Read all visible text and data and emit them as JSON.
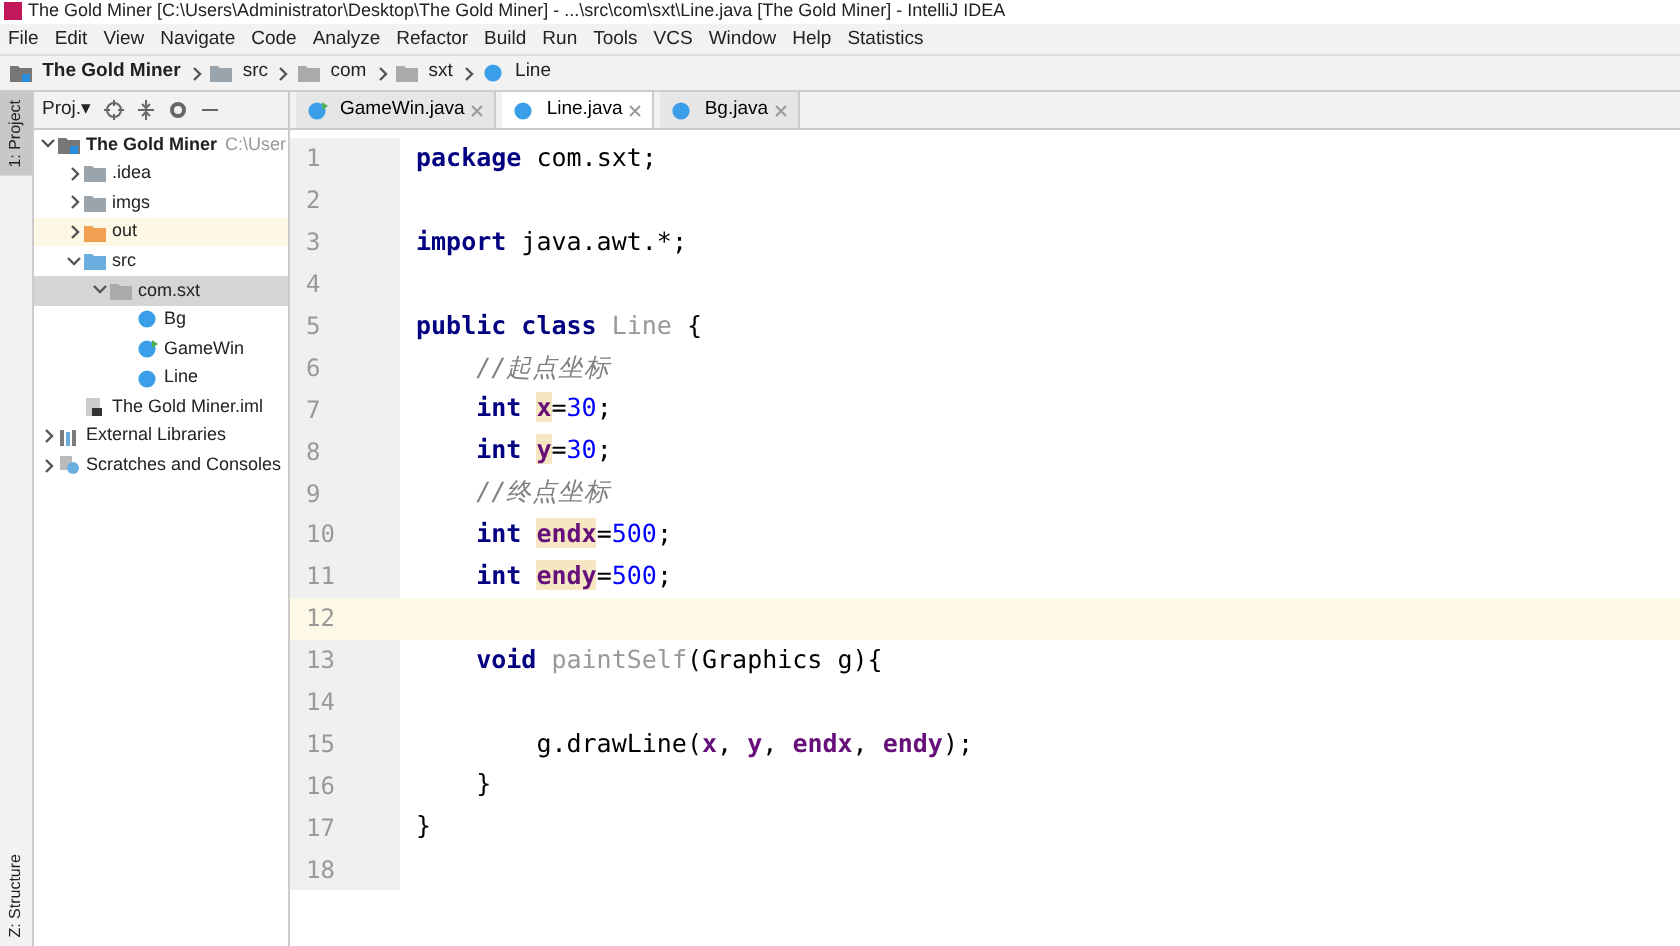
{
  "window": {
    "title": "The Gold Miner [C:\\Users\\Administrator\\Desktop\\The Gold Miner] - ...\\src\\com\\sxt\\Line.java [The Gold Miner] - IntelliJ IDEA"
  },
  "menu": [
    "File",
    "Edit",
    "View",
    "Navigate",
    "Code",
    "Analyze",
    "Refactor",
    "Build",
    "Run",
    "Tools",
    "VCS",
    "Window",
    "Help",
    "Statistics"
  ],
  "breadcrumb": [
    {
      "kind": "module",
      "label": "The Gold Miner"
    },
    {
      "kind": "folder",
      "label": "src"
    },
    {
      "kind": "package",
      "label": "com"
    },
    {
      "kind": "package",
      "label": "sxt"
    },
    {
      "kind": "class",
      "label": "Line"
    }
  ],
  "side_strip": [
    {
      "label": "1: Project",
      "selected": true
    },
    {
      "label": "Z: Structure",
      "selected": false
    }
  ],
  "project_panel": {
    "title": "Proj.▾"
  },
  "tree": [
    {
      "kind": "module",
      "label": "The Gold Miner",
      "path": "C:\\User",
      "expanded": true,
      "selected": false,
      "children": [
        {
          "kind": "folder",
          "label": ".idea",
          "expanded": false,
          "selected": false
        },
        {
          "kind": "folder",
          "label": "imgs",
          "expanded": false,
          "selected": false
        },
        {
          "kind": "excluded",
          "label": "out",
          "expanded": false,
          "selected": false
        },
        {
          "kind": "source",
          "label": "src",
          "expanded": true,
          "selected": false,
          "children": [
            {
              "kind": "package",
              "label": "com.sxt",
              "expanded": true,
              "selected": true,
              "children": [
                {
                  "kind": "class",
                  "label": "Bg",
                  "selected": false
                },
                {
                  "kind": "runnable",
                  "label": "GameWin",
                  "selected": false
                },
                {
                  "kind": "class",
                  "label": "Line",
                  "selected": false
                }
              ]
            }
          ]
        },
        {
          "kind": "iml",
          "label": "The Gold Miner.iml",
          "selected": false
        }
      ]
    },
    {
      "kind": "libraries",
      "label": "External Libraries",
      "expanded": false,
      "selected": false
    },
    {
      "kind": "scratches",
      "label": "Scratches and Consoles",
      "expanded": false,
      "selected": false
    }
  ],
  "tabs": [
    {
      "kind": "runnable",
      "label": "GameWin.java",
      "selected": false
    },
    {
      "kind": "class",
      "label": "Line.java",
      "selected": true
    },
    {
      "kind": "class",
      "label": "Bg.java",
      "selected": false
    }
  ],
  "lines": [
    {
      "number": "1",
      "current": false,
      "tokens": [
        {
          "kind": "kw",
          "text": "package"
        },
        {
          "kind": "plain",
          "text": " com.sxt;"
        }
      ]
    },
    {
      "number": "2",
      "current": false
    },
    {
      "number": "3",
      "current": false,
      "tokens": [
        {
          "kind": "kw",
          "text": "import"
        },
        {
          "kind": "plain",
          "text": " java.awt.*;"
        }
      ]
    },
    {
      "number": "4",
      "current": false
    },
    {
      "number": "5",
      "current": false,
      "tokens": [
        {
          "kind": "kw",
          "text": "public class "
        },
        {
          "kind": "unused",
          "text": "Line"
        },
        {
          "kind": "plain",
          "text": " {"
        }
      ]
    },
    {
      "number": "6",
      "current": false,
      "tokens": [
        {
          "kind": "comment",
          "text": "    //起点坐标"
        }
      ]
    },
    {
      "number": "7",
      "current": false,
      "tokens": [
        {
          "kind": "kw",
          "text": "    int "
        },
        {
          "kind": "decl",
          "text": "x"
        },
        {
          "kind": "plain",
          "text": "="
        },
        {
          "kind": "num",
          "text": "30"
        },
        {
          "kind": "plain",
          "text": ";"
        }
      ]
    },
    {
      "number": "8",
      "current": false,
      "tokens": [
        {
          "kind": "kw",
          "text": "    int "
        },
        {
          "kind": "decl",
          "text": "y"
        },
        {
          "kind": "plain",
          "text": "="
        },
        {
          "kind": "num",
          "text": "30"
        },
        {
          "kind": "plain",
          "text": ";"
        }
      ]
    },
    {
      "number": "9",
      "current": false,
      "tokens": [
        {
          "kind": "comment",
          "text": "    //终点坐标"
        }
      ]
    },
    {
      "number": "10",
      "current": false,
      "tokens": [
        {
          "kind": "kw",
          "text": "    int "
        },
        {
          "kind": "decl",
          "text": "endx"
        },
        {
          "kind": "plain",
          "text": "="
        },
        {
          "kind": "num",
          "text": "500"
        },
        {
          "kind": "plain",
          "text": ";"
        }
      ]
    },
    {
      "number": "11",
      "current": false,
      "tokens": [
        {
          "kind": "kw",
          "text": "    int "
        },
        {
          "kind": "decl",
          "text": "endy"
        },
        {
          "kind": "plain",
          "text": "="
        },
        {
          "kind": "num",
          "text": "500"
        },
        {
          "kind": "plain",
          "text": ";"
        }
      ]
    },
    {
      "number": "12",
      "current": true
    },
    {
      "number": "13",
      "current": false,
      "tokens": [
        {
          "kind": "kw",
          "text": "    void "
        },
        {
          "kind": "unused",
          "text": "paintSelf"
        },
        {
          "kind": "plain",
          "text": "(Graphics g){"
        }
      ]
    },
    {
      "number": "14",
      "current": false
    },
    {
      "number": "15",
      "current": false,
      "tokens": [
        {
          "kind": "plain",
          "text": "        g.drawLine("
        },
        {
          "kind": "field",
          "text": "x"
        },
        {
          "kind": "plain",
          "text": ", "
        },
        {
          "kind": "field",
          "text": "y"
        },
        {
          "kind": "plain",
          "text": ", "
        },
        {
          "kind": "field",
          "text": "endx"
        },
        {
          "kind": "plain",
          "text": ", "
        },
        {
          "kind": "field",
          "text": "endy"
        },
        {
          "kind": "plain",
          "text": ");"
        }
      ]
    },
    {
      "number": "16",
      "current": false,
      "tokens": [
        {
          "kind": "plain",
          "text": "    }"
        }
      ]
    },
    {
      "number": "17",
      "current": false,
      "tokens": [
        {
          "kind": "plain",
          "text": "}"
        }
      ]
    },
    {
      "number": "18",
      "current": false
    }
  ]
}
